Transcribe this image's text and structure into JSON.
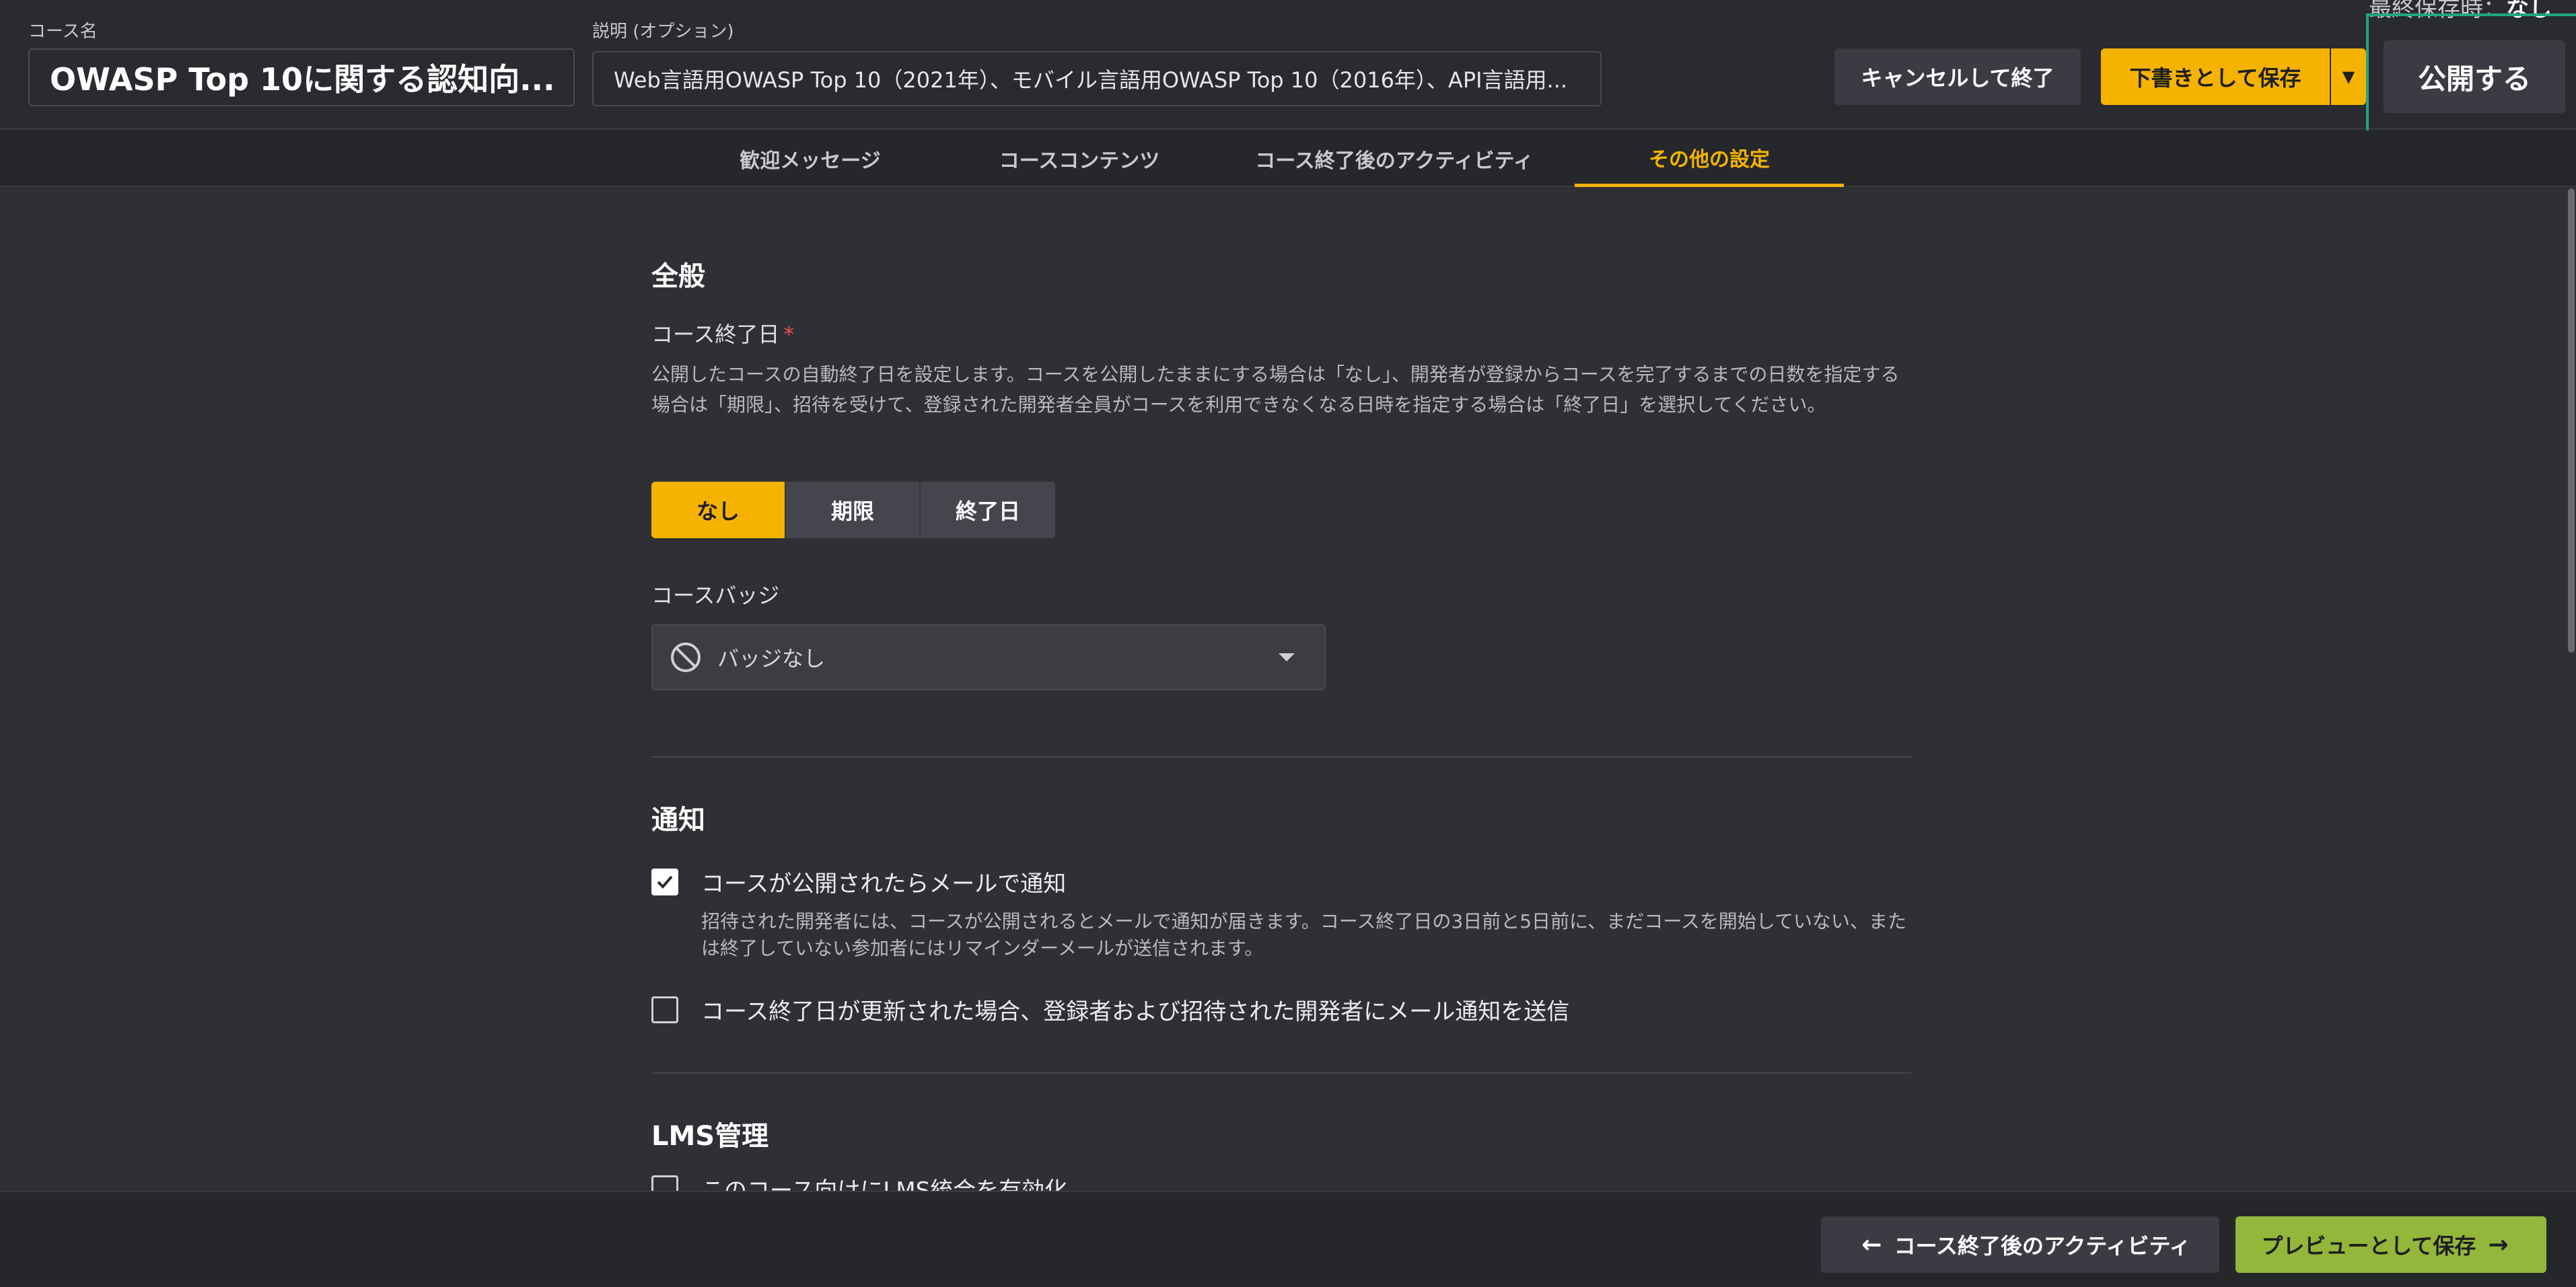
{
  "header": {
    "course_name_label": "コース名",
    "course_name_value": "OWASP Top 10に関する認知向...",
    "description_label": "説明 (オプション)",
    "description_value": "Web言語用OWASP Top 10（2021年）、モバイル言語用OWASP Top 10（2016年）、API言語用...",
    "autosave_label": "最終保存時：",
    "autosave_value": "なし",
    "cancel_label": "キャンセルして終了",
    "save_draft_label": "下書きとして保存",
    "publish_label": "公開する"
  },
  "tabs": [
    {
      "label": "歓迎メッセージ",
      "active": false
    },
    {
      "label": "コースコンテンツ",
      "active": false
    },
    {
      "label": "コース終了後のアクティビティ",
      "active": false
    },
    {
      "label": "その他の設定",
      "active": true
    }
  ],
  "general": {
    "title": "全般",
    "end_date_label": "コース終了日",
    "required_mark": "*",
    "end_date_help": "公開したコースの自動終了日を設定します。コースを公開したままにする場合は「なし」、開発者が登録からコースを完了するまでの日数を指定する場合は「期限」、招待を受けて、登録された開発者全員がコースを利用できなくなる日時を指定する場合は「終了日」を選択してください。",
    "end_date_options": [
      "なし",
      "期限",
      "終了日"
    ],
    "end_date_selected": "なし",
    "badge_label": "コースバッジ",
    "badge_value": "バッジなし"
  },
  "notifications": {
    "title": "通知",
    "notify_published_label": "コースが公開されたらメールで通知",
    "notify_published_checked": true,
    "notify_published_help": "招待された開発者には、コースが公開されるとメールで通知が届きます。コース終了日の3日前と5日前に、まだコースを開始していない、または終了していない参加者にはリマインダーメールが送信されます。",
    "notify_end_date_label": "コース終了日が更新された場合、登録者および招待された開発者にメール通知を送信",
    "notify_end_date_checked": false
  },
  "lms": {
    "title": "LMS管理",
    "enable_label": "このコース向けにLMS統合を有効化",
    "enable_checked": false
  },
  "footer": {
    "back_label": "コース終了後のアクティビティ",
    "preview_label": "プレビューとして保存"
  },
  "colors": {
    "accent": "#f5b300",
    "publish_frame": "#1fa77d",
    "preview_button": "#93b73a"
  }
}
